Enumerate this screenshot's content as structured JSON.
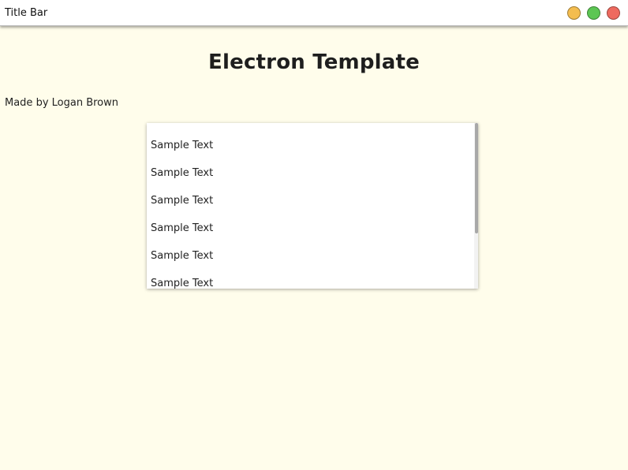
{
  "window": {
    "title": "Title Bar",
    "controls": [
      {
        "name": "minimize",
        "color": "#f4bd4f"
      },
      {
        "name": "maximize",
        "color": "#5cc653"
      },
      {
        "name": "close",
        "color": "#ee6a5f"
      }
    ]
  },
  "main": {
    "heading": "Electron Template",
    "author": "Made by Logan Brown",
    "list": {
      "items": [
        "Sample Text",
        "Sample Text",
        "Sample Text",
        "Sample Text",
        "Sample Text",
        "Sample Text"
      ]
    }
  },
  "colors": {
    "background": "#fffdeb",
    "titlebar": "#ffffff"
  }
}
